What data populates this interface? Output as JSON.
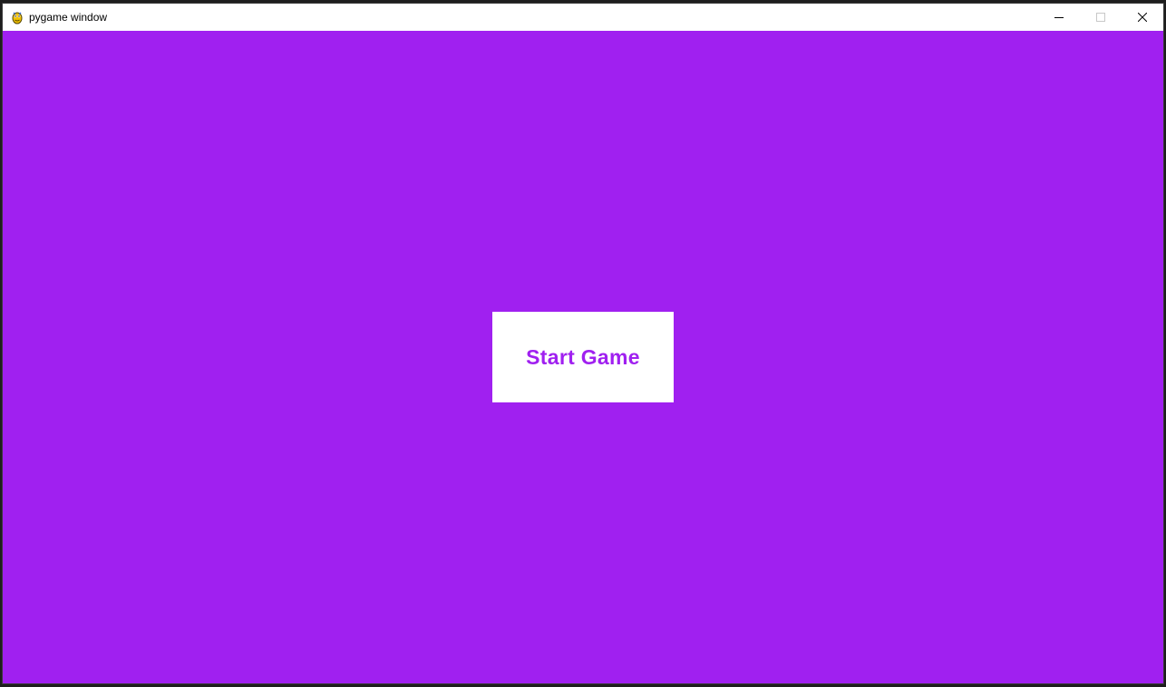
{
  "window": {
    "title": "pygame window",
    "app_icon": "pygame-snake-icon",
    "controls": {
      "minimize_icon": "minimize-icon",
      "maximize_icon": "maximize-icon",
      "close_icon": "close-icon",
      "maximize_enabled": false
    }
  },
  "game": {
    "background_color": "#a020f0",
    "start_button": {
      "label": "Start Game",
      "background_color": "#ffffff",
      "text_color": "#a020f0"
    }
  }
}
